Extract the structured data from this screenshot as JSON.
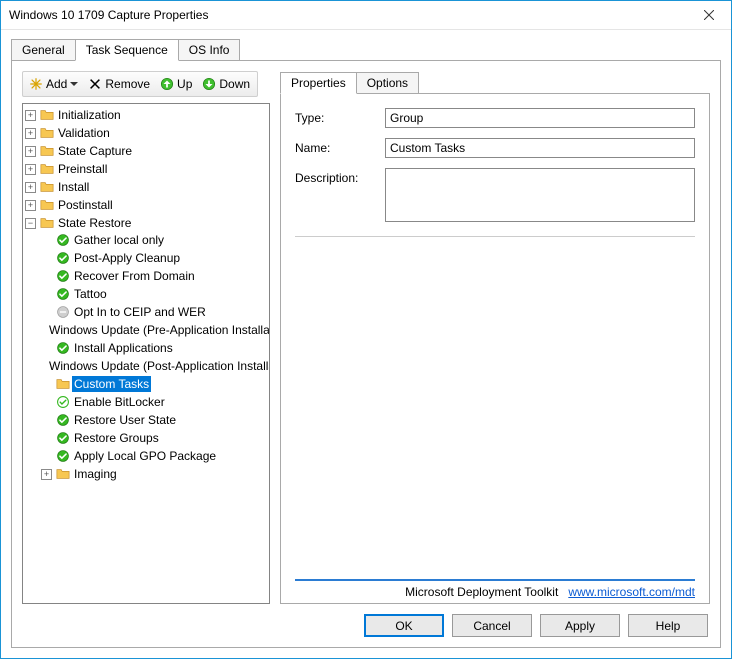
{
  "window": {
    "title": "Windows 10 1709 Capture Properties"
  },
  "outer_tabs": [
    "General",
    "Task Sequence",
    "OS Info"
  ],
  "outer_tabs_active": 1,
  "toolbar": {
    "add": "Add",
    "remove": "Remove",
    "up": "Up",
    "down": "Down"
  },
  "tree": [
    {
      "label": "Initialization",
      "icon": "folder",
      "expander": "+"
    },
    {
      "label": "Validation",
      "icon": "folder",
      "expander": "+"
    },
    {
      "label": "State Capture",
      "icon": "folder",
      "expander": "+"
    },
    {
      "label": "Preinstall",
      "icon": "folder",
      "expander": "+"
    },
    {
      "label": "Install",
      "icon": "folder",
      "expander": "+"
    },
    {
      "label": "Postinstall",
      "icon": "folder",
      "expander": "+"
    },
    {
      "label": "State Restore",
      "icon": "folder",
      "expander": "-",
      "children": [
        {
          "label": "Gather local only",
          "icon": "check"
        },
        {
          "label": "Post-Apply Cleanup",
          "icon": "check"
        },
        {
          "label": "Recover From Domain",
          "icon": "check"
        },
        {
          "label": "Tattoo",
          "icon": "check"
        },
        {
          "label": "Opt In to CEIP and WER",
          "icon": "disabled"
        },
        {
          "label": "Windows Update (Pre-Application Installation)",
          "icon": "disabled"
        },
        {
          "label": "Install Applications",
          "icon": "check"
        },
        {
          "label": "Windows Update (Post-Application Installation)",
          "icon": "disabled"
        },
        {
          "label": "Custom Tasks",
          "icon": "folder",
          "selected": true
        },
        {
          "label": "Enable BitLocker",
          "icon": "check-outline"
        },
        {
          "label": "Restore User State",
          "icon": "check"
        },
        {
          "label": "Restore Groups",
          "icon": "check"
        },
        {
          "label": "Apply Local GPO Package",
          "icon": "check"
        },
        {
          "label": "Imaging",
          "icon": "folder",
          "expander": "+"
        }
      ]
    }
  ],
  "inner_tabs": [
    "Properties",
    "Options"
  ],
  "inner_tabs_active": 0,
  "form": {
    "type_label": "Type:",
    "type_value": "Group",
    "name_label": "Name:",
    "name_value": "Custom Tasks",
    "desc_label": "Description:",
    "desc_value": ""
  },
  "footer": {
    "product": "Microsoft Deployment Toolkit",
    "link_text": "www.microsoft.com/mdt"
  },
  "buttons": {
    "ok": "OK",
    "cancel": "Cancel",
    "apply": "Apply",
    "help": "Help"
  }
}
